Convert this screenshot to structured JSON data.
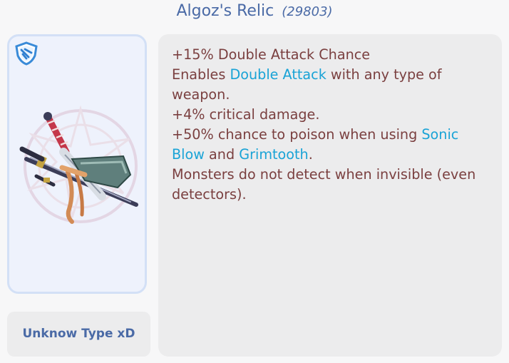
{
  "item": {
    "name": "Algoz's Relic",
    "id": "(29803)",
    "type": "Unknow Type xD"
  },
  "icons": {
    "badge": "shield-icon",
    "artwork": "relic-weapons-icon"
  },
  "description": {
    "line1": "+15% Double Attack Chance",
    "line2_pre": "Enables ",
    "line2_link": "Double Attack",
    "line2_post": " with any type of weapon.",
    "line3": "+4% critical damage.",
    "line4_pre": "+50% chance to poison when using ",
    "line4_link1": "Sonic Blow",
    "line4_mid": " and ",
    "line4_link2": "Grimtooth",
    "line4_post": ".",
    "line5": "Monsters do not detect when invisible (even detectors)."
  },
  "colors": {
    "title": "#4a6aa6",
    "description_text": "#7a3f3f",
    "skill_link": "#19a3d6",
    "panel_bg": "#ececed",
    "image_card_bg": "#eef2fc"
  }
}
